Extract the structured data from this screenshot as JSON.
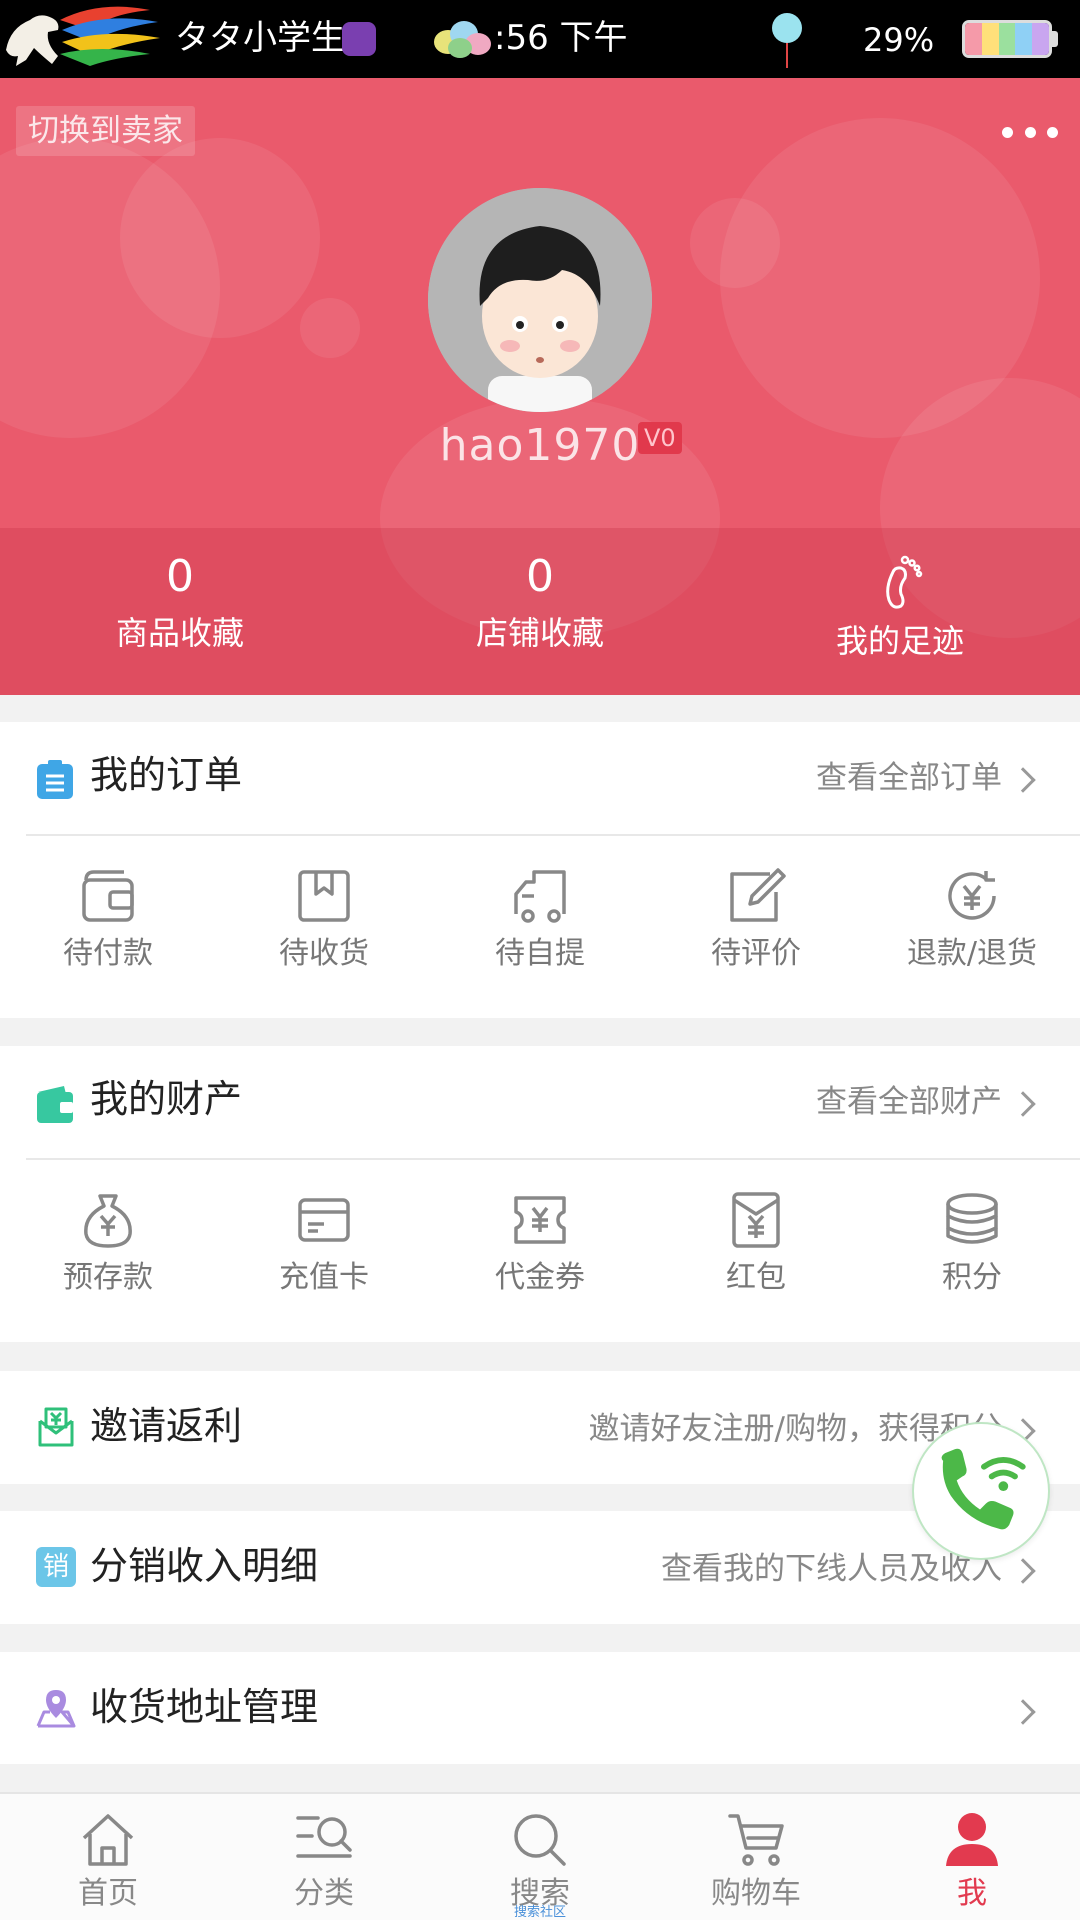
{
  "statusbar": {
    "name": "タタ小学生",
    "time": ":56 下午",
    "battery": "29%",
    "battery_colors": [
      "#f59aa9",
      "#ffe07a",
      "#9be09e",
      "#8fd0f5",
      "#c9a6f0"
    ]
  },
  "header": {
    "bg_color": "#ea5a6c",
    "switch_label": "切换到卖家",
    "username": "hao1970",
    "vip_level": "V0",
    "stats": [
      {
        "count": "0",
        "label": "商品收藏",
        "icon": "heart-icon"
      },
      {
        "count": "0",
        "label": "店铺收藏",
        "icon": "store-icon"
      },
      {
        "count": "",
        "label": "我的足迹",
        "icon": "footprint-icon"
      }
    ]
  },
  "orders": {
    "title": "我的订单",
    "link": "查看全部订单",
    "icon_color": "#3fa6e6",
    "items": [
      {
        "label": "待付款",
        "icon": "wallet-icon"
      },
      {
        "label": "待收货",
        "icon": "package-icon"
      },
      {
        "label": "待自提",
        "icon": "truck-icon"
      },
      {
        "label": "待评价",
        "icon": "edit-icon"
      },
      {
        "label": "退款/退货",
        "icon": "refund-icon"
      }
    ]
  },
  "assets": {
    "title": "我的财产",
    "link": "查看全部财产",
    "icon_color": "#37c8a0",
    "items": [
      {
        "label": "预存款",
        "icon": "money-bag-icon"
      },
      {
        "label": "充值卡",
        "icon": "card-icon"
      },
      {
        "label": "代金券",
        "icon": "coupon-icon"
      },
      {
        "label": "红包",
        "icon": "red-envelope-icon"
      },
      {
        "label": "积分",
        "icon": "coins-icon"
      }
    ]
  },
  "rows": [
    {
      "title": "邀请返利",
      "link": "邀请好友注册/购物，获得积分",
      "icon": "invite-icon"
    },
    {
      "title": "分销收入明细",
      "link": "查看我的下线人员及收入",
      "icon": "sales-icon",
      "badge": "销"
    },
    {
      "title": "收货地址管理",
      "link": "",
      "icon": "location-icon"
    }
  ],
  "tabbar": {
    "active_color": "#e23a4f",
    "tabs": [
      {
        "label": "首页",
        "icon": "home-icon"
      },
      {
        "label": "分类",
        "icon": "category-icon"
      },
      {
        "label": "搜索",
        "icon": "search-icon",
        "sub": "搜索社区"
      },
      {
        "label": "购物车",
        "icon": "cart-icon"
      },
      {
        "label": "我",
        "icon": "user-icon"
      }
    ]
  }
}
